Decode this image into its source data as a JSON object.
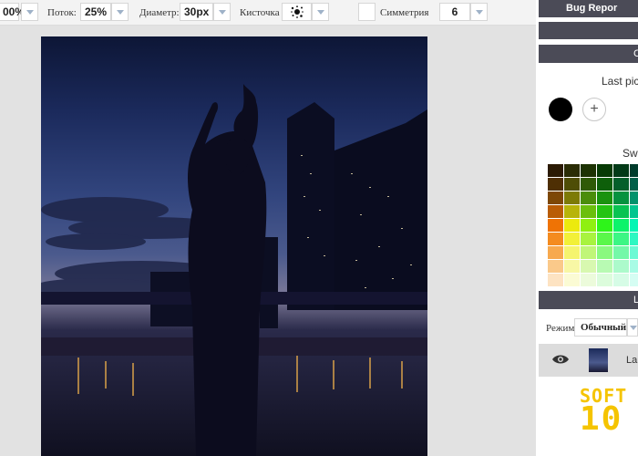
{
  "toolbar": {
    "opacity_value": "00%",
    "flow_label": "Поток:",
    "flow_value": "25%",
    "diameter_label": "Диаметр:",
    "diameter_value": "30px",
    "brush_label": "Кисточка",
    "brush_icon": "splat-brush-icon",
    "symmetry_label": "Симметрия",
    "symmetry_value": "6"
  },
  "panel": {
    "bug_report_label": "Bug Repor",
    "header_c": "C",
    "last_picked_label": "Last pic",
    "swatches_label": "Swa",
    "layers_header": "L",
    "mode_label": "Режим",
    "mode_value": "Обычный",
    "layer_name": "La"
  },
  "swatch_rows": [
    [
      "#2b1a04",
      "#2a2c05",
      "#1d3304",
      "#073a05",
      "#023a17",
      "#003c2c"
    ],
    [
      "#4e2f04",
      "#4e4d06",
      "#2f5a07",
      "#0e5f0a",
      "#045f2a",
      "#015f48"
    ],
    [
      "#7d4705",
      "#7d7a07",
      "#4b8d0b",
      "#1a920f",
      "#07923f",
      "#02926c"
    ],
    [
      "#b95c05",
      "#b7b40a",
      "#6bbf0d",
      "#24c413",
      "#09c352",
      "#02c690"
    ],
    [
      "#ef7305",
      "#ecea0e",
      "#8ff011",
      "#2ef41a",
      "#0cf36a",
      "#04f5b4"
    ],
    [
      "#f48b1f",
      "#f2f038",
      "#a8f33f",
      "#5af74a",
      "#3cf684",
      "#2ef7c2"
    ],
    [
      "#f7a94e",
      "#f5f46e",
      "#c0f678",
      "#8af97f",
      "#74f8a8",
      "#6cf9d4"
    ],
    [
      "#fac98a",
      "#f8f7a5",
      "#d8f8b0",
      "#b8fab3",
      "#acfacb",
      "#a8fbe5"
    ],
    [
      "#fde3c2",
      "#fbfbd4",
      "#ecfbdb",
      "#dcfcdc",
      "#d6fce6",
      "#d5fdf3"
    ]
  ],
  "logo": {
    "line1": "SOFT",
    "line2": "10"
  }
}
